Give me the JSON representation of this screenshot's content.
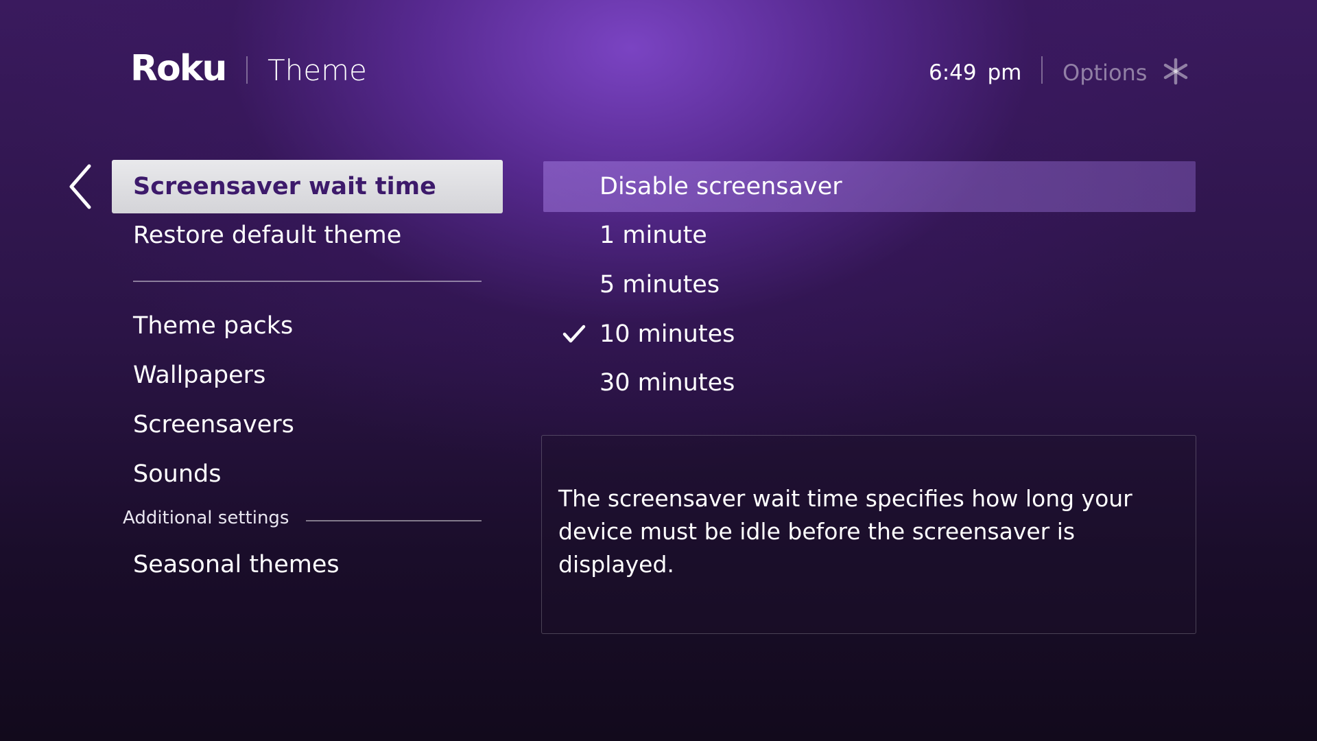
{
  "header": {
    "brand": "Roku",
    "title": "Theme",
    "time": "6:49 pm",
    "options_label": "Options",
    "options_icon": "asterisk-icon"
  },
  "left_menu": {
    "back_icon": "chevron-left-icon",
    "items": [
      {
        "label": "Screensaver wait time",
        "selected": true
      },
      {
        "label": "Restore default theme",
        "selected": false
      },
      {
        "label": "Theme packs",
        "selected": false
      },
      {
        "label": "Wallpapers",
        "selected": false
      },
      {
        "label": "Screensavers",
        "selected": false
      },
      {
        "label": "Sounds",
        "selected": false
      },
      {
        "label": "Seasonal themes",
        "selected": false
      }
    ],
    "additional_settings_label": "Additional settings"
  },
  "wait_time_options": {
    "items": [
      {
        "label": "Disable screensaver",
        "highlighted": true,
        "checked": false
      },
      {
        "label": "1 minute",
        "highlighted": false,
        "checked": false
      },
      {
        "label": "5 minutes",
        "highlighted": false,
        "checked": false
      },
      {
        "label": "10 minutes",
        "highlighted": false,
        "checked": true
      },
      {
        "label": "30 minutes",
        "highlighted": false,
        "checked": false
      }
    ],
    "check_icon": "checkmark-icon"
  },
  "info": {
    "text": "The screensaver wait time specifies how long your device must be idle before the screensaver is displayed."
  },
  "colors": {
    "background_accent": "#6a35b0",
    "selected_item_bg": "#dcdce0",
    "selected_item_text": "#3d1a6b",
    "highlight_row": "#8c64c8"
  }
}
